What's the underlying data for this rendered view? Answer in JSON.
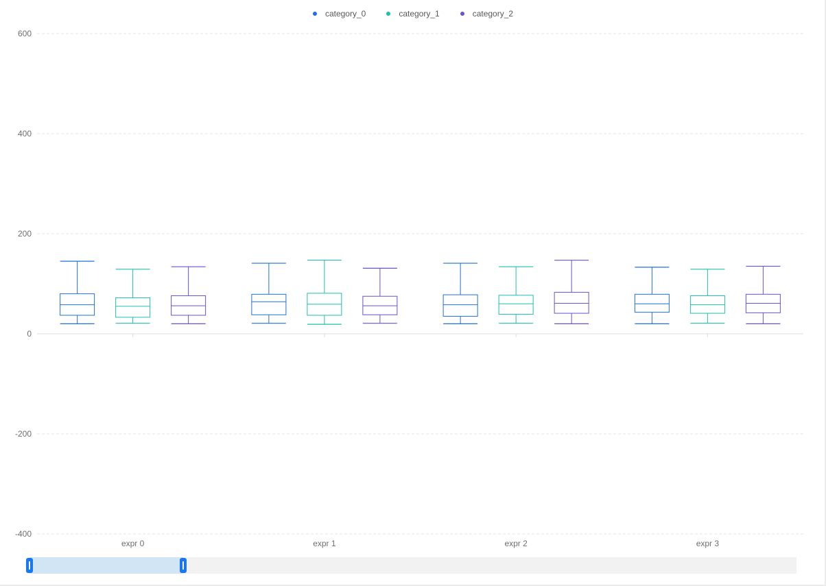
{
  "chart_data": {
    "type": "box",
    "categories": [
      "expr 0",
      "expr 1",
      "expr 2",
      "expr 3"
    ],
    "ylim": [
      -400,
      600
    ],
    "yticks": [
      -400,
      -200,
      0,
      200,
      400,
      600
    ],
    "grid": true,
    "legend_position": "top-center",
    "series": [
      {
        "name": "category_0",
        "color": "#1f6fe0",
        "boxes": [
          {
            "min": 20,
            "q1": 37,
            "median": 58,
            "q3": 80,
            "max": 145
          },
          {
            "min": 21,
            "q1": 38,
            "median": 64,
            "q3": 79,
            "max": 141
          },
          {
            "min": 20,
            "q1": 35,
            "median": 58,
            "q3": 78,
            "max": 141
          },
          {
            "min": 20,
            "q1": 43,
            "median": 60,
            "q3": 79,
            "max": 133
          }
        ]
      },
      {
        "name": "category_1",
        "color": "#1fbfae",
        "boxes": [
          {
            "min": 21,
            "q1": 33,
            "median": 55,
            "q3": 72,
            "max": 129
          },
          {
            "min": 19,
            "q1": 37,
            "median": 59,
            "q3": 81,
            "max": 147
          },
          {
            "min": 21,
            "q1": 39,
            "median": 60,
            "q3": 77,
            "max": 134
          },
          {
            "min": 21,
            "q1": 41,
            "median": 58,
            "q3": 76,
            "max": 129
          }
        ]
      },
      {
        "name": "category_2",
        "color": "#6b4fd8",
        "boxes": [
          {
            "min": 20,
            "q1": 37,
            "median": 56,
            "q3": 76,
            "max": 134
          },
          {
            "min": 21,
            "q1": 38,
            "median": 56,
            "q3": 75,
            "max": 131
          },
          {
            "min": 20,
            "q1": 41,
            "median": 61,
            "q3": 83,
            "max": 147
          },
          {
            "min": 20,
            "q1": 42,
            "median": 61,
            "q3": 79,
            "max": 135
          }
        ]
      }
    ]
  },
  "data_zoom": {
    "start_percent": 0,
    "end_percent": 20
  },
  "colors": {
    "grid": "#e6e6e6",
    "axis": "#dcdcdc",
    "tick_text": "#6e6e6e",
    "zoom_handle": "#1877f2",
    "zoom_fill": "#d2e5f5",
    "zoom_track": "#f2f2f2"
  }
}
